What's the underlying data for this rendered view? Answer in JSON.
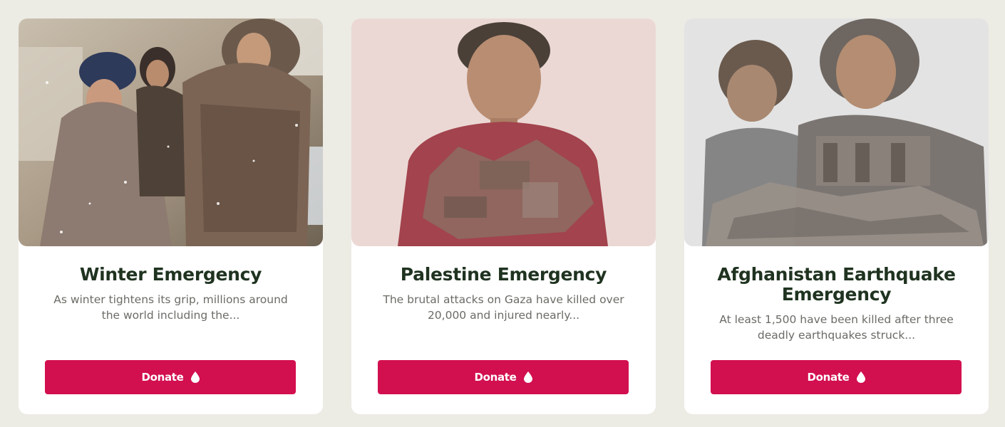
{
  "cards": [
    {
      "title": "Winter Emergency",
      "description": "As winter tightens its grip, millions around the world including the...",
      "button_label": "Donate",
      "icon": "water-drop-icon",
      "image": "children-in-winter-scarves-photo"
    },
    {
      "title": "Palestine Emergency",
      "description": "The brutal attacks on Gaza have killed over 20,000 and injured nearly...",
      "button_label": "Donate",
      "icon": "water-drop-icon",
      "image": "boy-with-rubble-overlay-photo"
    },
    {
      "title": "Afghanistan Earthquake Emergency",
      "description": "At least 1,500 have been killed after three deadly earthquakes struck...",
      "button_label": "Donate",
      "icon": "water-drop-icon",
      "image": "children-with-earthquake-rubble-photo"
    }
  ],
  "colors": {
    "background": "#ecebe4",
    "card": "#ffffff",
    "title": "#1f3320",
    "description": "#6b6b66",
    "button": "#d20f4f",
    "button_text": "#ffffff"
  }
}
